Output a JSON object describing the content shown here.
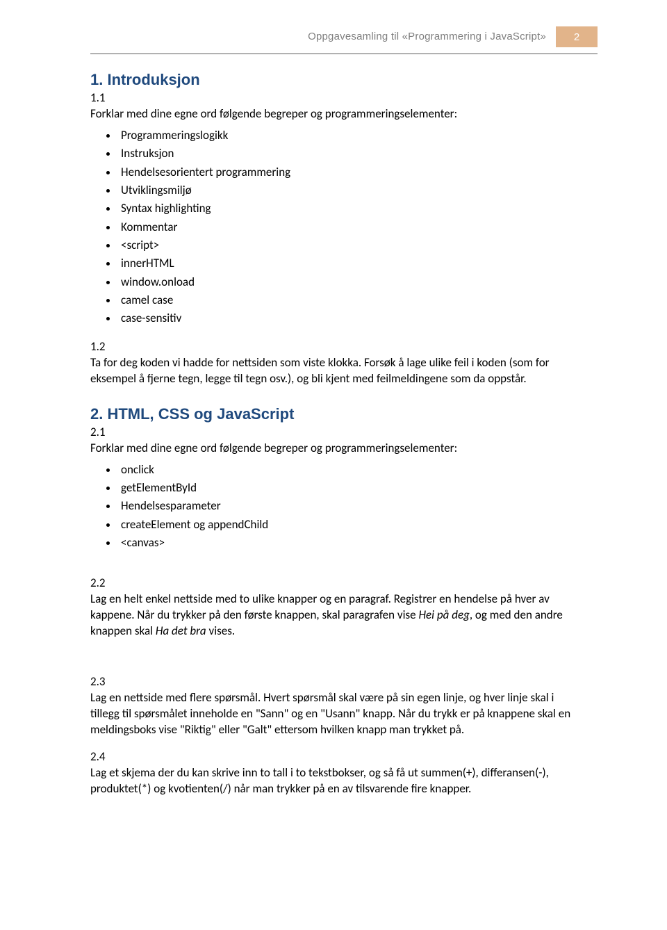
{
  "header": {
    "title": "Oppgavesamling til «Programmering i JavaScript»",
    "page_number": "2"
  },
  "s1": {
    "heading": "1. Introduksjon",
    "s11": {
      "number": "1.1",
      "intro": "Forklar med dine egne ord følgende begreper og programmeringselementer:",
      "items": [
        "Programmeringslogikk",
        "Instruksjon",
        "Hendelsesorientert programmering",
        "Utviklingsmiljø",
        "Syntax highlighting",
        "Kommentar",
        "<script>",
        "innerHTML",
        "window.onload",
        "camel case",
        "case-sensitiv"
      ]
    },
    "s12": {
      "number": "1.2",
      "text": "Ta for deg koden vi hadde for nettsiden som viste klokka. Forsøk å lage ulike feil i koden (som for eksempel å fjerne tegn, legge til tegn osv.), og bli kjent med feilmeldingene som da oppstår."
    }
  },
  "s2": {
    "heading": "2. HTML, CSS og JavaScript",
    "s21": {
      "number": "2.1",
      "intro": "Forklar med dine egne ord følgende begreper og programmeringselementer:",
      "items": [
        "onclick",
        "getElementById",
        "Hendelsesparameter",
        "createElement og appendChild",
        "<canvas>"
      ]
    },
    "s22": {
      "number": "2.2",
      "pre": "Lag en helt enkel nettside med to ulike knapper og en paragraf. Registrer en hendelse på hver av kappene. Når du trykker på den første knappen, skal paragrafen vise ",
      "it1": "Hei på deg",
      "mid": ", og med den andre knappen skal ",
      "it2": "Ha det bra",
      "post": " vises."
    },
    "s23": {
      "number": "2.3",
      "text": "Lag en nettside med flere spørsmål. Hvert spørsmål skal være på sin egen linje, og hver linje skal i tillegg til spørsmålet inneholde en \"Sann\" og en \"Usann\" knapp. Når du trykk er på knappene skal en meldingsboks vise \"Riktig\" eller \"Galt\" ettersom hvilken knapp man trykket på."
    },
    "s24": {
      "number": "2.4",
      "text": "Lag et skjema der du kan skrive inn to tall i to tekstbokser, og så få ut summen(+), differansen(-), produktet(*) og kvotienten(/) når man trykker på en av tilsvarende fire knapper."
    }
  }
}
